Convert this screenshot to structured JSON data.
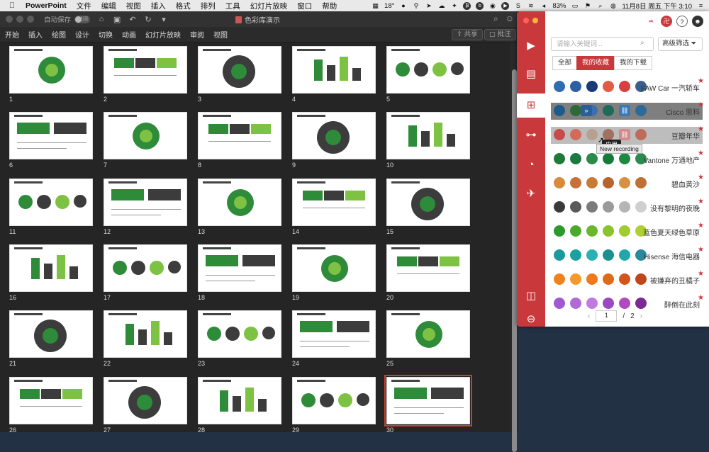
{
  "menubar": {
    "app_name": "PowerPoint",
    "items": [
      "文件",
      "编辑",
      "视图",
      "插入",
      "格式",
      "排列",
      "工具",
      "幻灯片放映",
      "窗口",
      "帮助"
    ],
    "status": {
      "weather": "18°",
      "battery": "83%",
      "datetime": "11月8日 周五 下午 3:10"
    }
  },
  "window": {
    "autosave_label": "自动保存",
    "autosave_state": "关闭",
    "document_title": "色彩库演示",
    "ribbon_tabs": [
      "开始",
      "插入",
      "绘图",
      "设计",
      "切换",
      "动画",
      "幻灯片放映",
      "审阅",
      "视图"
    ],
    "share_label": "共享",
    "comment_label": "批注"
  },
  "slides": [
    {
      "n": "1"
    },
    {
      "n": "2"
    },
    {
      "n": "3"
    },
    {
      "n": "4"
    },
    {
      "n": "5"
    },
    {
      "n": "6"
    },
    {
      "n": "7"
    },
    {
      "n": "8"
    },
    {
      "n": "9"
    },
    {
      "n": "10"
    },
    {
      "n": "11"
    },
    {
      "n": "12"
    },
    {
      "n": "13"
    },
    {
      "n": "14"
    },
    {
      "n": "15"
    },
    {
      "n": "16"
    },
    {
      "n": "17"
    },
    {
      "n": "18"
    },
    {
      "n": "19"
    },
    {
      "n": "20"
    },
    {
      "n": "21"
    },
    {
      "n": "22"
    },
    {
      "n": "23"
    },
    {
      "n": "24"
    },
    {
      "n": "25"
    },
    {
      "n": "26"
    },
    {
      "n": "27"
    },
    {
      "n": "28"
    },
    {
      "n": "29"
    },
    {
      "n": "30"
    }
  ],
  "selected_slide": "30",
  "panel": {
    "search_placeholder": "请输入关键词...",
    "advanced_filter": "高级筛选",
    "tabs": [
      "全部",
      "我的收藏",
      "我的下载"
    ],
    "active_tab": "我的收藏",
    "hover_tooltip": "应用",
    "recording_tooltip": "New recording",
    "palettes": [
      {
        "name": "FAW Car 一汽轿车",
        "colors": [
          "#2e6db0",
          "#2f5fa3",
          "#1a3a7a",
          "#e25b45",
          "#d94040",
          "#3a5f8a"
        ]
      },
      {
        "name": "Cisco 思科",
        "colors": [
          "#1d5c8a",
          "#2d6a3a",
          "#3b6fb0",
          "#1f6b5a",
          "#2a4a6a",
          "#2b6a9a"
        ]
      },
      {
        "name": "豆瓣年华",
        "colors": [
          "#c94a4a",
          "#d46a5a",
          "#b8a090",
          "#a07060",
          "#c08070",
          "#c06a5a"
        ]
      },
      {
        "name": "Vantone 万通地产",
        "colors": [
          "#1f7a3a",
          "#1a7a40",
          "#2a8a4a",
          "#167a3a",
          "#1b8a40",
          "#2a8a50"
        ]
      },
      {
        "name": "碧血黄沙",
        "colors": [
          "#d98a3a",
          "#c9703a",
          "#c97a35",
          "#b8652a",
          "#d99040",
          "#c07030"
        ]
      },
      {
        "name": "没有黎明的夜晚",
        "colors": [
          "#3a3a3a",
          "#5a5a5a",
          "#7a7a7a",
          "#9a9a9a",
          "#b5b5b5",
          "#cfcfcf"
        ]
      },
      {
        "name": "蓝色夏天绿色草原",
        "colors": [
          "#2a9a2a",
          "#4aaa2a",
          "#6ab82a",
          "#8ac42a",
          "#a0cc30",
          "#b0d030"
        ]
      },
      {
        "name": "Hisense 海信电器",
        "colors": [
          "#1a9a9a",
          "#1aa0a0",
          "#2ab0b0",
          "#1a9090",
          "#20a8a8",
          "#2a8a9a"
        ]
      },
      {
        "name": "被嫌弃的丑橘子",
        "colors": [
          "#f0821e",
          "#f59a2a",
          "#ee7a1a",
          "#e06a15",
          "#d4551a",
          "#c0451a"
        ]
      },
      {
        "name": "醉倒在此刻",
        "colors": [
          "#a05ad0",
          "#b06ad8",
          "#c07ae0",
          "#9a4ac0",
          "#b04ac0",
          "#7a2a90"
        ]
      }
    ],
    "pager": {
      "current": "1",
      "separator": "/",
      "total": "2"
    }
  },
  "colors": {
    "accent": "#c9383b"
  }
}
